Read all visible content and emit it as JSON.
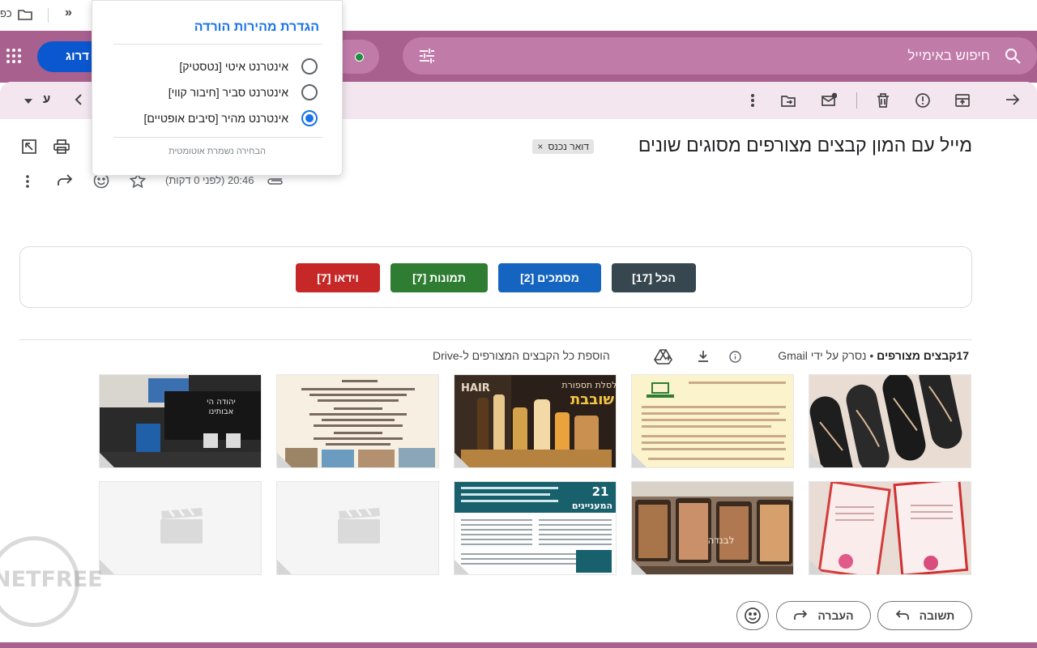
{
  "browser": {
    "tab_text": "כפ",
    "overflow_label": "»"
  },
  "header": {
    "search_placeholder": "חיפוש באימייל",
    "upgrade_label": "דרוג",
    "status_color": "#1e8e3e",
    "accent_color": "#a8608e"
  },
  "toolbar": {
    "letter": "ע"
  },
  "email": {
    "subject": "מייל עם המון קבצים מצורפים מסוגים שונים",
    "label": "דואר נכנס",
    "label_remove": "×",
    "time": "20:46 (לפני 0 דקות)"
  },
  "filters": [
    {
      "label": "הכל [17]",
      "color": "#37474f"
    },
    {
      "label": "מסמכים [2]",
      "color": "#1565c0"
    },
    {
      "label": "תמונות [7]",
      "color": "#2e7d32"
    },
    {
      "label": "וידאו [7]",
      "color": "#c62828"
    }
  ],
  "attachments": {
    "count_label": "17קבצים מצורפים",
    "scan_note": "• נסרק על ידי Gmail",
    "drive_label": "הוספת כל הקבצים המצורפים ל-Drive",
    "thumbnails": [
      {
        "kind": "image",
        "desc": "pens"
      },
      {
        "kind": "document",
        "desc": "note"
      },
      {
        "kind": "image",
        "desc": "gift-basket",
        "text1": "HAIR",
        "text2": "סלסלת תספורת",
        "text3": "שובבת"
      },
      {
        "kind": "image",
        "desc": "announcement"
      },
      {
        "kind": "image",
        "desc": "bag-items",
        "text1": "יהודה הי",
        "text2": "אבותינו"
      },
      {
        "kind": "image",
        "desc": "cards"
      },
      {
        "kind": "image",
        "desc": "pastries",
        "text1": "לבנדה"
      },
      {
        "kind": "document",
        "desc": "newsletter",
        "text1": "21",
        "text2": "המעניינים"
      },
      {
        "kind": "video",
        "desc": "video1"
      },
      {
        "kind": "video",
        "desc": "video2"
      }
    ]
  },
  "actions": {
    "reply": "תשובה",
    "forward": "העברה"
  },
  "watermark": {
    "text": "NETFREE"
  },
  "speed_popup": {
    "title": "הגדרת מהירות הורדה",
    "options": [
      {
        "label": "אינטרנט איטי [נטסטיק]",
        "selected": false
      },
      {
        "label": "אינטרנט סביר [חיבור קווי]",
        "selected": false
      },
      {
        "label": "אינטרנט מהיר [סיבים אופטיים]",
        "selected": true
      }
    ],
    "note": "הבחירה נשמרת אוטומטית"
  }
}
